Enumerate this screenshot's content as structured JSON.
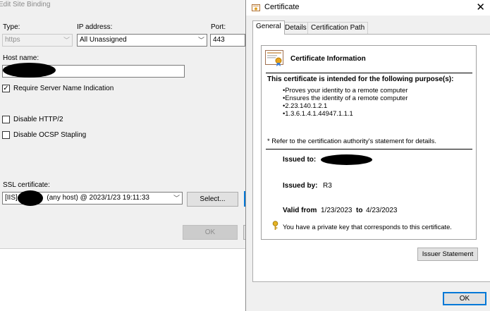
{
  "edit_binding": {
    "title": "Edit Site Binding",
    "type_label": "Type:",
    "type_value": "https",
    "ip_label": "IP address:",
    "ip_value": "All Unassigned",
    "port_label": "Port:",
    "port_value": "443",
    "host_label": "Host name:",
    "sni_label": "Require Server Name Indication",
    "sni_checked": true,
    "http2_label": "Disable HTTP/2",
    "ocsp_label": "Disable OCSP Stapling",
    "ssl_label": "SSL certificate:",
    "ssl_prefix": "[IIS]",
    "ssl_suffix": "(any host) @ 2023/1/23 19:11:33",
    "select_button": "Select...",
    "ok_button": "OK"
  },
  "certificate": {
    "title": "Certificate",
    "close_glyph": "✕",
    "tabs": [
      "General",
      "Details",
      "Certification Path"
    ],
    "info_heading": "Certificate Information",
    "purpose_heading": "This certificate is intended for the following purpose(s):",
    "purposes": [
      "Proves your identity to a remote computer",
      "Ensures the identity of a remote computer",
      "2.23.140.1.2.1",
      "1.3.6.1.4.1.44947.1.1.1"
    ],
    "refer_note": "* Refer to the certification authority's statement for details.",
    "issued_to_label": "Issued to:",
    "issued_by_label": "Issued by:",
    "issued_by_value": "R3",
    "valid_from_label": "Valid from",
    "valid_from_value": "1/23/2023",
    "valid_to_label": "to",
    "valid_to_value": "4/23/2023",
    "private_key_note": "You have a private key that corresponds to this certificate.",
    "issuer_statement_button": "Issuer Statement",
    "ok_button": "OK"
  },
  "icons": {
    "certificate": "certificate-icon",
    "key": "key-icon",
    "chevron": "chevron-down-icon",
    "check": "checkmark-icon"
  },
  "colors": {
    "ok_focus_border": "#0078d7",
    "panel_bg": "#f0f0f0"
  }
}
